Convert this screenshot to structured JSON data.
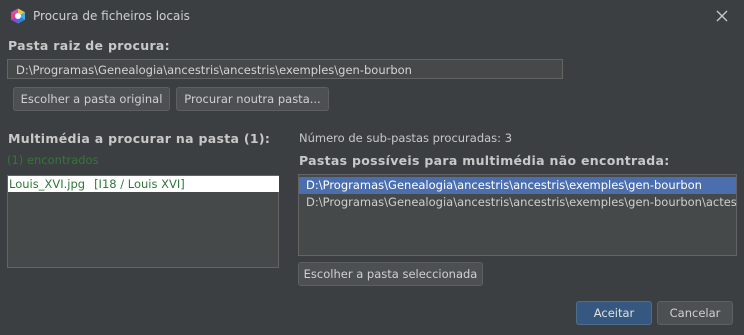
{
  "window": {
    "title": "Procura de ficheiros locais",
    "app_icon": "ancestris-logo-icon",
    "close_icon": "close-icon"
  },
  "root": {
    "label": "Pasta raiz de procura:",
    "path": "D:\\Programas\\Genealogia\\ancestris\\ancestris\\exemples\\gen-bourbon",
    "choose_original_label": "Escolher a pasta original",
    "search_other_label": "Procurar noutra pasta..."
  },
  "media": {
    "label": "Multimédia a procurar na pasta (1):",
    "found_text": "(1) encontrados",
    "items": [
      {
        "file": "Louis_XVI.jpg",
        "tag": "[I18 / Louis XVI]"
      }
    ]
  },
  "folders": {
    "count_text": "Número de sub-pastas procuradas: 3",
    "label": "Pastas possíveis para multimédia não encontrada:",
    "items": [
      "D:\\Programas\\Genealogia\\ancestris\\ancestris\\exemples\\gen-bourbon",
      "D:\\Programas\\Genealogia\\ancestris\\ancestris\\exemples\\gen-bourbon\\actes"
    ],
    "selected_index": 0,
    "choose_selected_label": "Escolher a pasta seleccionada"
  },
  "footer": {
    "accept_label": "Aceitar",
    "cancel_label": "Cancelar"
  },
  "colors": {
    "background": "#3c3f41",
    "found_green": "#32773a",
    "selection_blue": "#4b6eaf",
    "primary_button": "#365880"
  }
}
